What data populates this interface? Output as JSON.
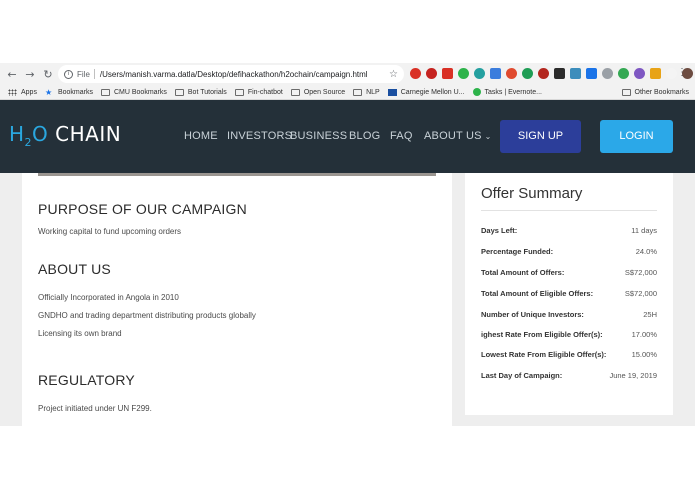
{
  "browser": {
    "url": "/Users/manish.varma.datla/Desktop/defihackathon/h2ochain/campaign.html",
    "scheme_label": "File",
    "bookmarks": [
      {
        "label": "Apps",
        "icon": "apps-grid-icon"
      },
      {
        "label": "Bookmarks",
        "icon": "star-icon"
      },
      {
        "label": "CMU Bookmarks",
        "icon": "folder-icon"
      },
      {
        "label": "Bot Tutorials",
        "icon": "folder-icon"
      },
      {
        "label": "Fin-chatbot",
        "icon": "folder-icon"
      },
      {
        "label": "Open Source",
        "icon": "folder-icon"
      },
      {
        "label": "NLP",
        "icon": "folder-icon"
      },
      {
        "label": "Carnegie Mellon U...",
        "icon": "cmu-icon"
      },
      {
        "label": "Tasks | Evernote...",
        "icon": "evernote-icon"
      }
    ],
    "other_bookmarks": "Other Bookmarks"
  },
  "site": {
    "logo_h2o": "H",
    "logo_sub": "2",
    "logo_o": "O",
    "logo_chain": " CHAIN",
    "nav": [
      "HOME",
      "INVESTORS",
      "BUSINESS",
      "BLOG",
      "FAQ",
      "ABOUT US"
    ],
    "signup_label": "SIGN UP",
    "login_label": "LOGIN"
  },
  "campaign": {
    "purpose_title": "PURPOSE OF OUR CAMPAIGN",
    "purpose_text": "Working capital to fund upcoming orders",
    "about_title": "ABOUT US",
    "about_lines": [
      "Officially Incorporated in Angola in 2010",
      "GNDHO and trading department distributing products globally",
      "Licensing its own brand"
    ],
    "regulatory_title": "REGULATORY",
    "regulatory_text": "Project initiated under UN F299."
  },
  "offer": {
    "title": "Offer Summary",
    "rows": [
      {
        "label": "Days Left:",
        "value": "11 days"
      },
      {
        "label": "Percentage Funded:",
        "value": "24.0%"
      },
      {
        "label": "Total Amount of Offers:",
        "value": "S$72,000"
      },
      {
        "label": "Total Amount of Eligible Offers:",
        "value": "S$72,000"
      },
      {
        "label": "Number of Unique Investors:",
        "value": "25H"
      },
      {
        "label": "ighest Rate From Eligible Offer(s):",
        "value": "17.00%"
      },
      {
        "label": "Lowest Rate From Eligible Offer(s):",
        "value": "15.00%"
      },
      {
        "label": "Last Day of Campaign:",
        "value": "June 19, 2019"
      }
    ]
  },
  "colors": {
    "header_bg": "#243039",
    "brand_blue": "#2aa7df",
    "signup_bg": "#2c3e9a",
    "login_bg": "#2ba8e8"
  }
}
